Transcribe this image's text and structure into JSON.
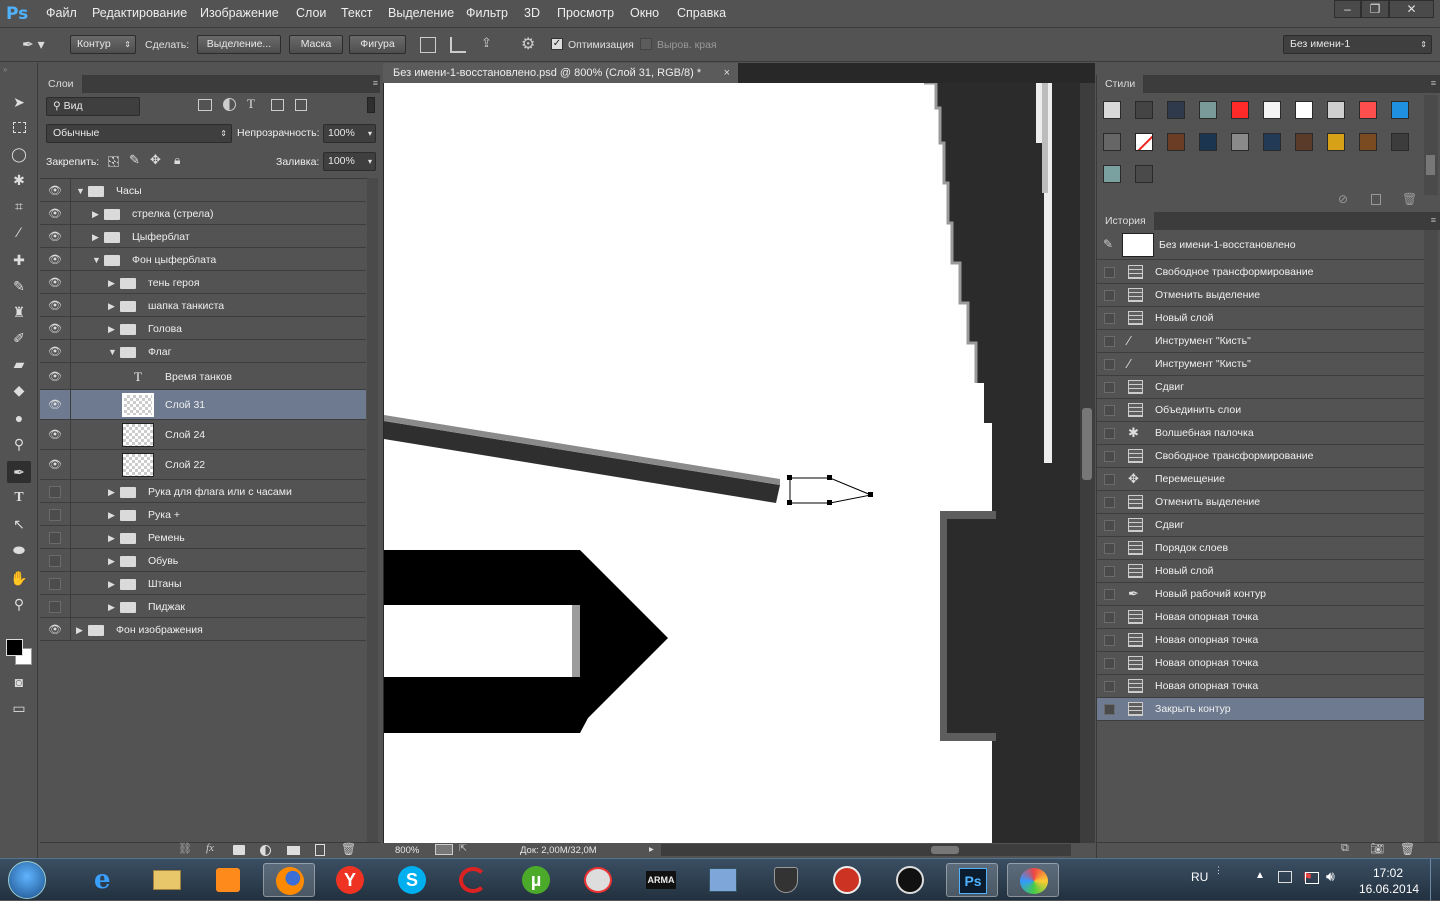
{
  "app": {
    "logo": "Ps"
  },
  "menu": [
    "Файл",
    "Редактирование",
    "Изображение",
    "Слои",
    "Текст",
    "Выделение",
    "Фильтр",
    "3D",
    "Просмотр",
    "Окно",
    "Справка"
  ],
  "options": {
    "mode": "Контур",
    "make_label": "Сделать:",
    "selection_btn": "Выделение...",
    "mask_btn": "Маска",
    "shape_btn": "Фигура",
    "optimize_label": "Оптимизация",
    "align_edges_label": "Выров. края",
    "workspace": "Без имени-1"
  },
  "layers_panel": {
    "tab": "Слои",
    "filter_kind": "Вид",
    "blend_mode": "Обычные",
    "opacity_label": "Непрозрачность:",
    "opacity_value": "100%",
    "lock_label": "Закрепить:",
    "fill_label": "Заливка:",
    "fill_value": "100%",
    "layers": [
      {
        "name": "Часы",
        "type": "group",
        "indent": 0,
        "expanded": true,
        "visible": true
      },
      {
        "name": "стрелка (стрела)",
        "type": "group",
        "indent": 1,
        "expanded": false,
        "visible": true
      },
      {
        "name": "Цыферблат",
        "type": "group",
        "indent": 1,
        "expanded": false,
        "visible": true
      },
      {
        "name": "Фон цыферблата",
        "type": "group",
        "indent": 1,
        "expanded": true,
        "visible": true
      },
      {
        "name": "тень героя",
        "type": "group",
        "indent": 2,
        "expanded": false,
        "visible": true
      },
      {
        "name": "шапка танкиста",
        "type": "group",
        "indent": 2,
        "expanded": false,
        "visible": true
      },
      {
        "name": "Голова",
        "type": "group",
        "indent": 2,
        "expanded": false,
        "visible": true
      },
      {
        "name": "Флаг",
        "type": "group",
        "indent": 2,
        "expanded": true,
        "visible": true
      },
      {
        "name": "Время танков",
        "type": "text",
        "indent": 3,
        "visible": true
      },
      {
        "name": "Слой 31",
        "type": "pixel",
        "indent": 3,
        "visible": true,
        "selected": true
      },
      {
        "name": "Слой 24",
        "type": "pixel",
        "indent": 3,
        "visible": true
      },
      {
        "name": "Слой 22",
        "type": "pixel",
        "indent": 3,
        "visible": true
      },
      {
        "name": "Рука для флага или с часами",
        "type": "group",
        "indent": 2,
        "expanded": false,
        "visible": false
      },
      {
        "name": "Рука +",
        "type": "group",
        "indent": 2,
        "expanded": false,
        "visible": false
      },
      {
        "name": "Ремень",
        "type": "group",
        "indent": 2,
        "expanded": false,
        "visible": false
      },
      {
        "name": "Обувь",
        "type": "group",
        "indent": 2,
        "expanded": false,
        "visible": false
      },
      {
        "name": "Штаны",
        "type": "group",
        "indent": 2,
        "expanded": false,
        "visible": false
      },
      {
        "name": "Пиджак",
        "type": "group",
        "indent": 2,
        "expanded": false,
        "visible": false
      },
      {
        "name": "Фон изображения",
        "type": "group",
        "indent": 0,
        "expanded": false,
        "visible": true
      }
    ]
  },
  "document": {
    "tab_title": "Без имени-1-восстановлено.psd @ 800% (Слой 31, RGB/8) *",
    "zoom": "800%",
    "doc_size": "Док: 2,00M/32,0M"
  },
  "styles_panel": {
    "tab": "Стили",
    "swatches": [
      "#d8d8d8",
      "#444444",
      "#2f3a4c",
      "#7a9a9a",
      "#ff2a2a",
      "#f4f4f4",
      "#ffffff",
      "#cfcfcf",
      "#ff4e4e",
      "#1f8fe0",
      "#666666",
      "#ffffff",
      "#6b3d25",
      "#1b3450",
      "#8a8a8a",
      "#223a56",
      "#5a3a28",
      "#d6a017",
      "#7a4a20",
      "#3c3c3c",
      "#7aa0a0",
      "#4a4a4a"
    ]
  },
  "history_panel": {
    "tab": "История",
    "snapshot": "Без имени-1-восстановлено",
    "items": [
      {
        "label": "Свободное трансформирование",
        "icon": "doc"
      },
      {
        "label": "Отменить выделение",
        "icon": "doc"
      },
      {
        "label": "Новый слой",
        "icon": "doc"
      },
      {
        "label": "Инструмент \"Кисть\"",
        "icon": "brush"
      },
      {
        "label": "Инструмент \"Кисть\"",
        "icon": "brush"
      },
      {
        "label": "Сдвиг",
        "icon": "doc"
      },
      {
        "label": "Объединить слои",
        "icon": "doc"
      },
      {
        "label": "Волшебная палочка",
        "icon": "wand"
      },
      {
        "label": "Свободное трансформирование",
        "icon": "doc"
      },
      {
        "label": "Перемещение",
        "icon": "move"
      },
      {
        "label": "Отменить выделение",
        "icon": "doc"
      },
      {
        "label": "Сдвиг",
        "icon": "doc"
      },
      {
        "label": "Порядок слоев",
        "icon": "doc"
      },
      {
        "label": "Новый слой",
        "icon": "doc"
      },
      {
        "label": "Новый рабочий контур",
        "icon": "pen"
      },
      {
        "label": "Новая опорная точка",
        "icon": "doc"
      },
      {
        "label": "Новая опорная точка",
        "icon": "doc"
      },
      {
        "label": "Новая опорная точка",
        "icon": "doc"
      },
      {
        "label": "Новая опорная точка",
        "icon": "doc"
      },
      {
        "label": "Закрыть контур",
        "icon": "doc",
        "selected": true
      }
    ]
  },
  "taskbar": {
    "lang": "RU",
    "time": "17:02",
    "date": "16.06.2014"
  }
}
